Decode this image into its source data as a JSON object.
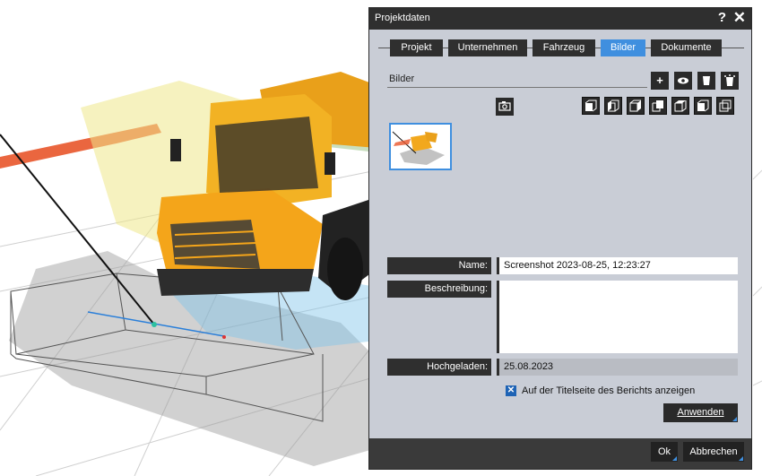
{
  "dialog": {
    "title": "Projektdaten",
    "help_label": "?",
    "close_label": "✕"
  },
  "tabs": [
    {
      "label": "Projekt",
      "active": false
    },
    {
      "label": "Unternehmen",
      "active": false
    },
    {
      "label": "Fahrzeug",
      "active": false
    },
    {
      "label": "Bilder",
      "active": true
    },
    {
      "label": "Dokumente",
      "active": false
    }
  ],
  "images_section": {
    "label": "Bilder",
    "toolbar": {
      "add_icon": "plus-icon",
      "view_icon": "eye-icon",
      "delete_icon": "trash-icon",
      "delete_all_icon": "trash-all-icon",
      "camera_icon": "camera-icon"
    },
    "view_buttons": [
      "view-front-icon",
      "view-left-icon",
      "view-right-icon",
      "view-back-icon",
      "view-top-icon",
      "view-iso-icon",
      "view-multi-icon"
    ]
  },
  "fields": {
    "name_label": "Name:",
    "name_value": "Screenshot 2023-08-25, 12:23:27",
    "description_label": "Beschreibung:",
    "description_value": "",
    "uploaded_label": "Hochgeladen:",
    "uploaded_value": "25.08.2023"
  },
  "checkbox": {
    "checked": true,
    "label": "Auf der Titelseite des Berichts anzeigen"
  },
  "buttons": {
    "apply": "Anwenden",
    "ok": "Ok",
    "cancel": "Abbrechen"
  },
  "colors": {
    "accent": "#3f8fdf",
    "dark": "#2f2f2f",
    "dialog_bg": "#c9cdd6",
    "truck": "#f2a81d"
  }
}
